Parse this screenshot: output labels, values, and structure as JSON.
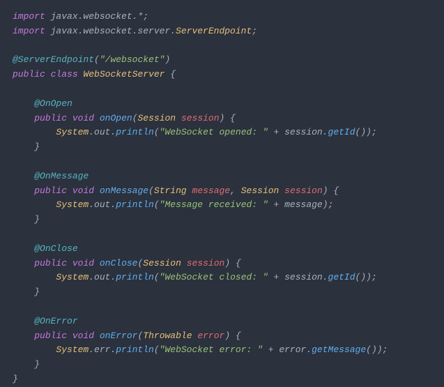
{
  "code": {
    "import1_kw": "import",
    "import1_pkg": " javax.websocket.*;",
    "import2_kw": "import",
    "import2_pkg": " javax.websocket.server.",
    "import2_cls": "ServerEndpoint",
    "import2_end": ";",
    "anno_server": "@ServerEndpoint",
    "anno_server_arg": "(\"/websocket\")",
    "kw_public": "public",
    "kw_class": "class",
    "cls_name": "WebSocketServer",
    "brace_open": " {",
    "anno_onopen": "@OnOpen",
    "kw_void": "void",
    "m_onopen": "onOpen",
    "type_session": "Session",
    "p_session": "session",
    "paren_open": "(",
    "paren_close": ")",
    "brace_o": " {",
    "sys": "System",
    "dot_out": ".out.",
    "dot_err": ".err.",
    "println": "println",
    "str_opened": "\"WebSocket opened: \"",
    "plus": " + ",
    "getid": "getId",
    "call_end": "());",
    "brace_c": "}",
    "anno_onmessage": "@OnMessage",
    "m_onmessage": "onMessage",
    "type_string": "String",
    "p_message": "message",
    "comma": ", ",
    "str_received": "\"Message received: \"",
    "msg_end": "message);",
    "anno_onclose": "@OnClose",
    "m_onclose": "onClose",
    "str_closed": "\"WebSocket closed: \"",
    "anno_onerror": "@OnError",
    "m_onerror": "onError",
    "type_throwable": "Throwable",
    "p_error": "error",
    "str_error": "\"WebSocket error: \"",
    "err_var": "error.",
    "getmessage": "getMessage",
    "session_dot": "session."
  }
}
